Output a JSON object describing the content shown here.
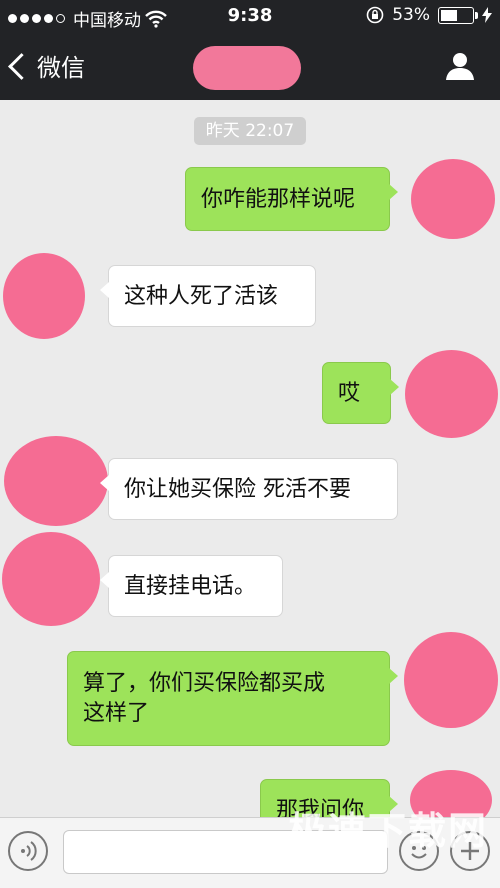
{
  "status_bar": {
    "carrier": "中国移动",
    "time": "9:38",
    "battery": "53%",
    "battery_level": 0.53
  },
  "nav": {
    "back_label": "微信"
  },
  "chat": {
    "timestamp": "昨天 22:07",
    "messages": [
      {
        "sender": "me",
        "text": "你咋能那样说呢"
      },
      {
        "sender": "other",
        "text": "这种人死了活该"
      },
      {
        "sender": "me",
        "text": "哎"
      },
      {
        "sender": "other",
        "text": "你让她买保险 死活不要"
      },
      {
        "sender": "other",
        "text": "直接挂电话。"
      },
      {
        "sender": "me",
        "text_line1": "算了，你们买保险都买成",
        "text_line2": "这样了"
      },
      {
        "sender": "me",
        "text": "那我问你"
      }
    ]
  },
  "input_bar": {
    "placeholder": ""
  },
  "watermark": "极速下载网",
  "icons": [
    "signal-dots-icon",
    "wifi-icon",
    "rotation-lock-icon",
    "battery-icon",
    "charging-bolt-icon",
    "back-chevron-icon",
    "person-icon",
    "voice-icon",
    "emoji-icon",
    "plus-icon"
  ],
  "colors": {
    "bar_bg": "#222326",
    "chat_bg": "#ebebeb",
    "my_bubble": "#9de35a",
    "other_bubble": "#ffffff",
    "redaction": "#f56c93"
  }
}
